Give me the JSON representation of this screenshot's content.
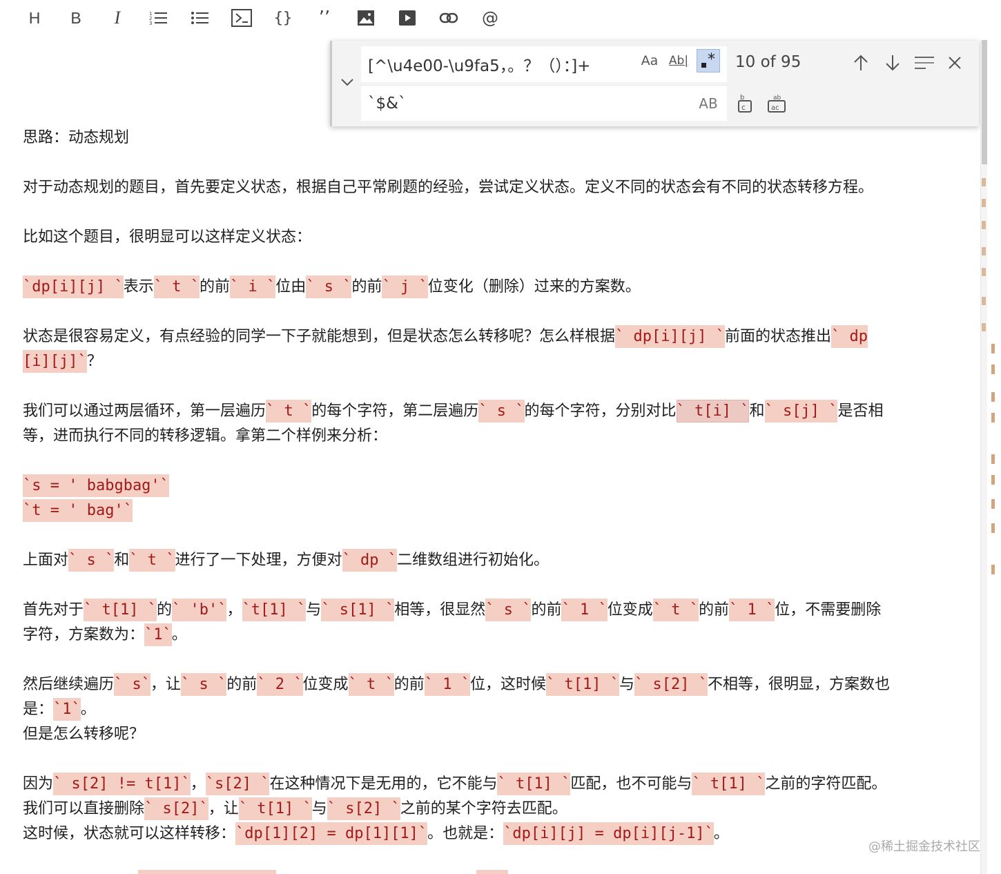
{
  "toolbar": {
    "heading_label": "H",
    "bold_label": "B",
    "italic_label": "I",
    "code_block_label": "{}",
    "quote_label": "’’",
    "mention_label": "@",
    "icons": [
      "ordered-list-icon",
      "unordered-list-icon",
      "terminal-icon",
      "image-icon",
      "video-icon",
      "link-icon"
    ]
  },
  "find": {
    "search_value": "[^\\u4e00-\\u9fa5，。？（）：]+",
    "match_case_label": "Aa",
    "whole_word_label": "Ab|",
    "count": "10 of 95",
    "replace_value": "`$&`",
    "preserve_case_label": "AB"
  },
  "doc": {
    "p1": "思路：动态规划",
    "p2": "对于动态规划的题目，首先要定义状态，根据自己平常刷题的经验，尝试定义状态。定义不同的状态会有不同的状态转移方程。",
    "p3": "比如这个题目，很明显可以这样定义状态：",
    "p4": {
      "a": "`dp[i][j] `",
      "b": "表示",
      "c": "` t `",
      "d": "的前",
      "e": "` i `",
      "f": "位由",
      "g": "` s `",
      "h": "的前",
      "i": "` j `",
      "j": "位变化（删除）过来的方案数。"
    },
    "p5": {
      "a": "状态是很容易定义，有点经验的同学一下子就能想到，但是状态怎么转移呢？怎么样根据",
      "b": "` dp[i][j] `",
      "c": "前面的状态推出",
      "d": "` dp",
      "e": "[i][j]`",
      "f": "？"
    },
    "p6": {
      "a": "我们可以通过两层循环，第一层遍历",
      "b": "` t `",
      "c": "的每个字符，第二层遍历",
      "d": "` s `",
      "e": "的每个字符，分别对比",
      "f": "` t[i] `",
      "g": "和",
      "h": "` s[j] `",
      "i": "是否相",
      "j": "等，进而执行不同的转移逻辑。拿第二个样例来分析："
    },
    "p7": {
      "a": "`s = ' babgbag'`",
      "b": "`t = ' bag'`"
    },
    "p8": {
      "a": "上面对",
      "b": "` s `",
      "c": "和",
      "d": "` t `",
      "e": "进行了一下处理，方便对",
      "f": "` dp `",
      "g": "二维数组进行初始化。"
    },
    "p9": {
      "a": "首先对于",
      "b": "` t[1] `",
      "c": "的",
      "d": "` 'b'`",
      "e": "，",
      "f": "`t[1] `",
      "g": "与",
      "h": "` s[1] `",
      "i": "相等，很显然",
      "j": "` s `",
      "k": "的前",
      "l": "` 1 `",
      "m": "位变成",
      "n": "` t `",
      "o": "的前",
      "p": "` 1 `",
      "q": "位，不需要删除",
      "r": "字符，方案数为：",
      "s": "`1`",
      "t": "。"
    },
    "p10": {
      "a": "然后继续遍历",
      "b": "` s`",
      "c": "，让",
      "d": "` s `",
      "e": "的前",
      "f": "` 2 `",
      "g": "位变成",
      "h": "` t `",
      "i": "的前",
      "j": "` 1 `",
      "k": "位，这时候",
      "l": "` t[1] `",
      "m": "与",
      "n": "` s[2] `",
      "o": "不相等，很明显，方案数也",
      "p": "是：",
      "q": "`1`",
      "r": "。",
      "s": "但是怎么转移呢？"
    },
    "p11": {
      "a": "因为",
      "b": "` s[2] != t[1]`",
      "c": "，",
      "d": "`s[2] `",
      "e": "在这种情况下是无用的，它不能与",
      "f": "` t[1] `",
      "g": "匹配，也不可能与",
      "h": "` t[1] `",
      "i": "之前的字符匹配。",
      "j": "我们可以直接删除",
      "k": "` s[2]`",
      "l": "，让",
      "m": "` t[1] `",
      "n": "与",
      "o": "` s[2] `",
      "p": "之前的某个字符去匹配。",
      "q": "这时候，状态就可以这样转移：",
      "r": "`dp[1][2] = dp[1][1]`",
      "s": "。也就是：",
      "t": "`dp[i][j] = dp[i][j-1]`",
      "u": "。"
    }
  },
  "watermark": "@稀土掘金技术社区",
  "colors": {
    "highlight": "#f6cfc4",
    "highlight_text": "#a11a1a",
    "active_toggle": "#c8d8f0"
  }
}
